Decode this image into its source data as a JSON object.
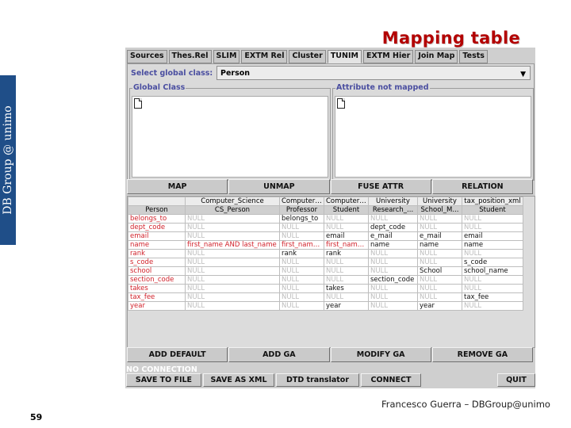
{
  "slide": {
    "title": "Mapping table",
    "side_text": "DB Group @ unimo",
    "footer": "Francesco Guerra – DBGroup@unimo",
    "page_number": "59"
  },
  "tabs": [
    "Sources",
    "Thes.Rel",
    "SLIM",
    "EXTM Rel",
    "Cluster",
    "TUNIM",
    "EXTM Hier",
    "Join Map",
    "Tests"
  ],
  "active_tab": "TUNIM",
  "class_selector": {
    "label": "Select global class:",
    "value": "Person"
  },
  "panels": {
    "global_class": "Global Class",
    "attr_not_mapped": "Attribute not mapped"
  },
  "action_buttons": [
    "MAP",
    "UNMAP",
    "FUSE ATTR",
    "RELATION"
  ],
  "table": {
    "sources": [
      "Computer_Science",
      "Computer_...",
      "Computer_...",
      "University",
      "University",
      "tax_position_xml"
    ],
    "header_left": "Person",
    "local_classes": [
      "CS_Person",
      "Professor",
      "Student",
      "Research_...",
      "School_M...",
      "Student"
    ],
    "rows": [
      {
        "name": "belongs_to",
        "cells": [
          "NULL",
          "belongs_to",
          "NULL",
          "NULL",
          "NULL",
          "NULL"
        ]
      },
      {
        "name": "dept_code",
        "cells": [
          "NULL",
          "NULL",
          "NULL",
          "dept_code",
          "NULL",
          "NULL"
        ]
      },
      {
        "name": "email",
        "cells": [
          "NULL",
          "NULL",
          "email",
          "e_mail",
          "e_mail",
          "email"
        ]
      },
      {
        "name": "name",
        "cells": [
          "first_name AND last_name",
          "first_name...",
          "first_name...",
          "name",
          "name",
          "name"
        ]
      },
      {
        "name": "rank",
        "cells": [
          "NULL",
          "rank",
          "rank",
          "NULL",
          "NULL",
          "NULL"
        ]
      },
      {
        "name": "s_code",
        "cells": [
          "NULL",
          "NULL",
          "NULL",
          "NULL",
          "NULL",
          "s_code"
        ]
      },
      {
        "name": "school",
        "cells": [
          "NULL",
          "NULL",
          "NULL",
          "NULL",
          "School",
          "school_name"
        ]
      },
      {
        "name": "section_code",
        "cells": [
          "NULL",
          "NULL",
          "NULL",
          "section_code",
          "NULL",
          "NULL"
        ]
      },
      {
        "name": "takes",
        "cells": [
          "NULL",
          "NULL",
          "takes",
          "NULL",
          "NULL",
          "NULL"
        ]
      },
      {
        "name": "tax_fee",
        "cells": [
          "NULL",
          "NULL",
          "NULL",
          "NULL",
          "NULL",
          "tax_fee"
        ]
      },
      {
        "name": "year",
        "cells": [
          "NULL",
          "NULL",
          "year",
          "NULL",
          "year",
          "NULL"
        ]
      }
    ]
  },
  "ga_buttons": [
    "ADD DEFAULT",
    "ADD GA",
    "MODIFY GA",
    "REMOVE GA"
  ],
  "status": "NO CONNECTION",
  "bottom_buttons": [
    "SAVE TO FILE",
    "SAVE AS XML",
    "DTD translator",
    "CONNECT",
    "QUIT"
  ]
}
